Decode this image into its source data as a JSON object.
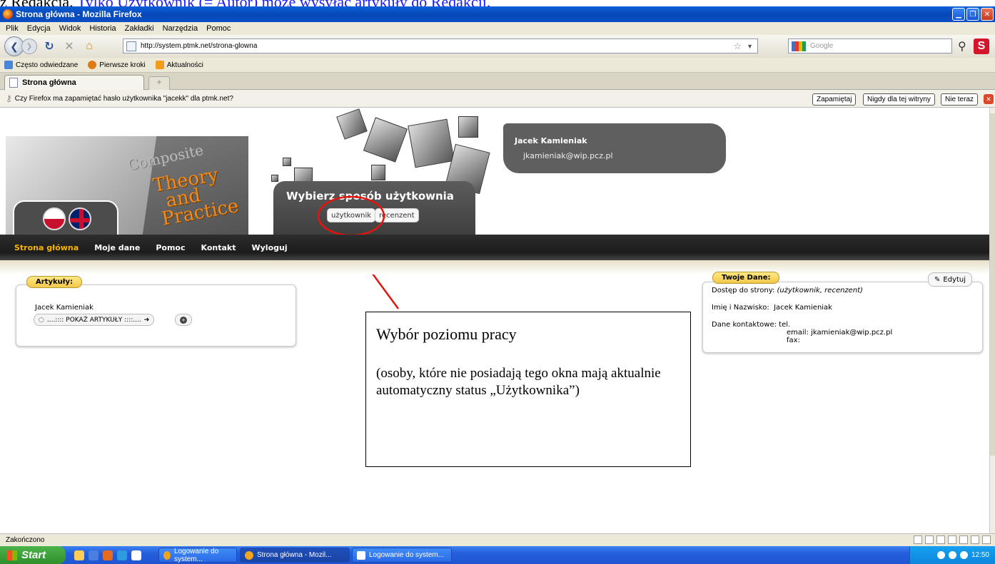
{
  "doc_top": {
    "prefix": "z Redakcją. ",
    "blue": "Tylko Użytkownik (= Autor) może wysyłać artykuły do Redakcji."
  },
  "window": {
    "title": "Strona główna - Mozilla Firefox"
  },
  "menu": [
    "Plik",
    "Edycja",
    "Widok",
    "Historia",
    "Zakładki",
    "Narzędzia",
    "Pomoc"
  ],
  "nav": {
    "url": "http://system.ptmk.net/strona-glowna",
    "search_placeholder": "Google"
  },
  "bookmarks": [
    "Często odwiedzane",
    "Pierwsze kroki",
    "Aktualności"
  ],
  "tab": {
    "label": "Strona główna"
  },
  "notification": {
    "text": "Czy Firefox ma zapamiętać hasło użytkownika \"jacekk\" dla ptmk.net?",
    "btn_save": "Zapamiętaj",
    "btn_never": "Nigdy dla tej witryny",
    "btn_not_now": "Nie teraz"
  },
  "site": {
    "logo_line1": "Composite",
    "logo_line2": "Theory",
    "logo_line3": "and",
    "logo_line4": "Practice",
    "user_name": "Jacek Kamieniak",
    "user_email": "jkamieniak@wip.pcz.pl",
    "mode_title": "Wybierz sposób użytkownia",
    "mode_user": "użytkownik",
    "mode_reviewer": "recenzent",
    "nav": [
      "Strona główna",
      "Moje dane",
      "Pomoc",
      "Kontakt",
      "Wyloguj"
    ]
  },
  "articles": {
    "header": "Artykuły:",
    "author": "Jacek Kamieniak",
    "show_btn": "....:::: POKAŻ ARTYKUŁY ::::...."
  },
  "your_data": {
    "header": "Twoje Dane:",
    "edit": "Edytuj",
    "access_label": "Dostęp do strony:",
    "access_value": "(użytkownik, recenzent)",
    "name_label": "Imię i Nazwisko:",
    "name_value": "Jacek Kamieniak",
    "contact_label": "Dane kontaktowe:",
    "contact_tel": "tel.",
    "contact_email": "email: jkamieniak@wip.pcz.pl",
    "contact_fax": "fax:"
  },
  "annotation": {
    "title": "Wybór poziomu pracy",
    "body": "(osoby, które nie posiadają tego okna mają aktualnie automatyczny status „Użytkownika”)"
  },
  "status": {
    "text": "Zakończono"
  },
  "taskbar": {
    "start": "Start",
    "items": [
      "Logowanie do system...",
      "Strona główna - Mozil...",
      "Logowanie do system..."
    ],
    "clock": "12:50"
  }
}
